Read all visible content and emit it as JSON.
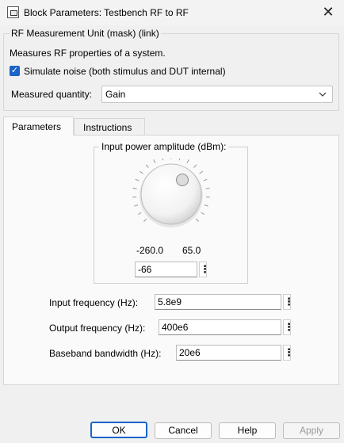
{
  "window": {
    "title": "Block Parameters: Testbench RF to RF",
    "close_glyph": "✕"
  },
  "mask": {
    "group_label": "RF Measurement Unit (mask) (link)",
    "description": "Measures RF properties of a system."
  },
  "simulate_noise": {
    "checked": true,
    "label": "Simulate noise (both stimulus and DUT internal)"
  },
  "measured_quantity": {
    "label": "Measured quantity:",
    "value": "Gain"
  },
  "tabs": [
    {
      "label": "Parameters",
      "active": true
    },
    {
      "label": "Instructions",
      "active": false
    }
  ],
  "knob": {
    "title": "Input power amplitude (dBm):",
    "min": "-260.0",
    "max": "65.0",
    "value": "-66"
  },
  "params": [
    {
      "label": "Input frequency (Hz):",
      "value": "5.8e9"
    },
    {
      "label": "Output frequency (Hz):",
      "value": "400e6"
    },
    {
      "label": "Baseband bandwidth (Hz):",
      "value": "20e6"
    }
  ],
  "buttons": {
    "ok": "OK",
    "cancel": "Cancel",
    "help": "Help",
    "apply": "Apply"
  },
  "icons": {
    "check": "✓",
    "chevron": "⌵",
    "dots": "⋮"
  }
}
